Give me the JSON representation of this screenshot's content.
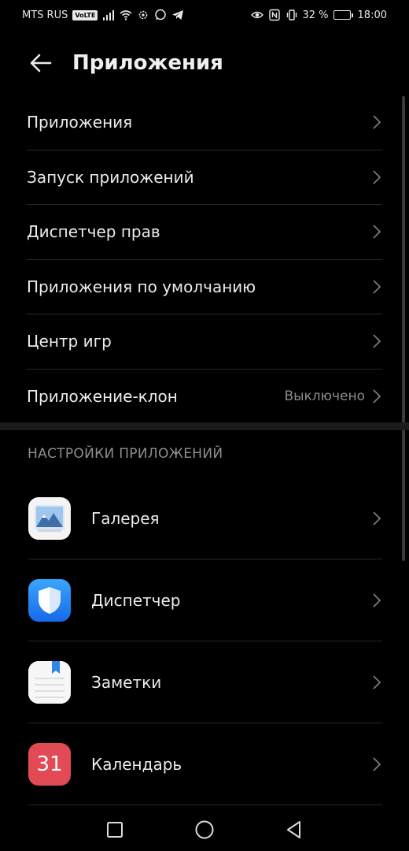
{
  "status_bar": {
    "carrier": "MTS RUS",
    "volte": "VoLTE",
    "battery_percent_text": "32 %",
    "battery_level": 0.32,
    "time": "18:00"
  },
  "header": {
    "title": "Приложения"
  },
  "menu": {
    "items": [
      {
        "label": "Приложения",
        "value": ""
      },
      {
        "label": "Запуск приложений",
        "value": ""
      },
      {
        "label": "Диспетчер прав",
        "value": ""
      },
      {
        "label": "Приложения по умолчанию",
        "value": ""
      },
      {
        "label": "Центр игр",
        "value": ""
      },
      {
        "label": "Приложение-клон",
        "value": "Выключено"
      }
    ]
  },
  "app_settings": {
    "section_title": "НАСТРОЙКИ ПРИЛОЖЕНИЙ",
    "apps": [
      {
        "name": "Галерея",
        "icon": "gallery-icon"
      },
      {
        "name": "Диспетчер",
        "icon": "shield-icon"
      },
      {
        "name": "Заметки",
        "icon": "notes-icon"
      },
      {
        "name": "Календарь",
        "icon": "calendar-icon",
        "icon_text": "31"
      }
    ]
  },
  "colors": {
    "background": "#000000",
    "calendar_red": "#e24a55",
    "manager_blue": "#1f7df0"
  }
}
